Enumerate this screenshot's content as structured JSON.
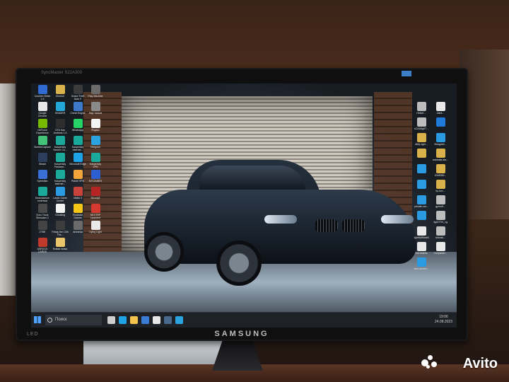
{
  "photo": {
    "monitor_brand": "SAMSUNG",
    "monitor_model_text": "SyncMaster S22A300",
    "led_label": "LED",
    "watermark_text": "Avito"
  },
  "desktop": {
    "left_icons": [
      {
        "label": "Counter-Strike 1.6",
        "color": "#2f6bd1"
      },
      {
        "label": "Личное",
        "color": "#d9b14a"
      },
      {
        "label": "Grand Theft Auto V",
        "color": "#3b3b3b"
      },
      {
        "label": "Play Machine",
        "color": "#6b6b6b"
      },
      {
        "label": "Google Chrome",
        "color": "#e8e8e8"
      },
      {
        "label": "SHADER",
        "color": "#23a7d9"
      },
      {
        "label": "Cheat Engine",
        "color": "#3e79c9"
      },
      {
        "label": "Мир танков",
        "color": "#8a8a8a"
      },
      {
        "label": "GeForce Experience",
        "color": "#76b900"
      },
      {
        "label": "GTA San Andreas 1.0",
        "color": "#2d2d2d"
      },
      {
        "label": "WhatsApp",
        "color": "#25d366"
      },
      {
        "label": "Яндекс",
        "color": "#f4f4f4"
      },
      {
        "label": "ScreenCapture",
        "color": "#44c277"
      },
      {
        "label": "Kaspersky Secure Co...",
        "color": "#1aa99a"
      },
      {
        "label": "Kaspersky Internet...",
        "color": "#1aa99a"
      },
      {
        "label": "Telegram",
        "color": "#2aa3e0"
      },
      {
        "label": "Steam",
        "color": "#2b3f5c"
      },
      {
        "label": "Kaspersky Passwor...",
        "color": "#1aa99a"
      },
      {
        "label": "Microsoft Edge",
        "color": "#1ea4e6"
      },
      {
        "label": "Kaspersky VPN",
        "color": "#1aa99a"
      },
      {
        "label": "Speedfan",
        "color": "#3a6fd6"
      },
      {
        "label": "Kaspersky Internet...",
        "color": "#1aa99a"
      },
      {
        "label": "Planet VPN",
        "color": "#f2a33a"
      },
      {
        "label": "MY.GAMES",
        "color": "#2e5fd1"
      },
      {
        "label": "Безопасные платежи",
        "color": "#1aa99a"
      },
      {
        "label": "Lastic Game Center",
        "color": "#2a9be0"
      },
      {
        "label": "Mafia II",
        "color": "#c9433a"
      },
      {
        "label": "Bloody8",
        "color": "#b52525"
      },
      {
        "label": "Euro Truck Simulator 2",
        "color": "#4a4a4a"
      },
      {
        "label": "Ghosting",
        "color": "#f2f2f2"
      },
      {
        "label": "Rockstar Games",
        "color": "#f5c518"
      },
      {
        "label": "NEXTRP Launcher",
        "color": "#d4392f"
      },
      {
        "label": "ZTBE",
        "color": "#444444"
      },
      {
        "label": "Friday the 13th The...",
        "color": "#3d3d3d"
      },
      {
        "label": "Amnesia",
        "color": "#6a6a6a"
      },
      {
        "label": "Dying Light",
        "color": "#e9e9e9"
      },
      {
        "label": "ASROCK CARDS",
        "color": "#c03a2b"
      },
      {
        "label": "Новая папка",
        "color": "#e9c46a"
      }
    ],
    "right_icons": [
      {
        "label": "HelloK...",
        "color": "#bcbcbc"
      },
      {
        "label": "2ab4...",
        "color": "#e8e8e8"
      },
      {
        "label": "sCAAAg07...",
        "color": "#bcbcbc"
      },
      {
        "label": "",
        "color": "#1f7ad9"
      },
      {
        "label": "dibly-ogm...",
        "color": "#d9b14a"
      },
      {
        "label": "Mosgwer...",
        "color": "#2a9be0"
      },
      {
        "label": "",
        "color": "#d9b14a"
      },
      {
        "label": "australia-sta...",
        "color": "#d9b14a"
      },
      {
        "label": "",
        "color": "#2a9be0"
      },
      {
        "label": "2018060...",
        "color": "#d9b14a"
      },
      {
        "label": "",
        "color": "#2a9be0"
      },
      {
        "label": "ky-kvo...",
        "color": "#d9b14a"
      },
      {
        "label": "private-car...",
        "color": "#2a9be0"
      },
      {
        "label": "gyrno5...",
        "color": "#bcbcbc"
      },
      {
        "label": "",
        "color": "#2a9be0"
      },
      {
        "label": "4gs1YXe_vg",
        "color": "#bcbcbc"
      },
      {
        "label": "1gm6aWotal4",
        "color": "#e8e8e8"
      },
      {
        "label": "dobosk...",
        "color": "#bcbcbc"
      },
      {
        "label": "Без имени",
        "color": "#e8e8e8"
      },
      {
        "label": "Сохранен...",
        "color": "#e8e8e8"
      },
      {
        "label": "new-screen...",
        "color": "#2a9be0"
      }
    ],
    "search_placeholder": "Поиск",
    "clock_time": "19:06",
    "clock_date": "24.08.2023",
    "taskbar_icons": [
      {
        "name": "task-view-icon",
        "color": "#cfcfcf"
      },
      {
        "name": "edge-icon",
        "color": "#1ea4e6"
      },
      {
        "name": "explorer-icon",
        "color": "#f2c14e"
      },
      {
        "name": "store-icon",
        "color": "#3a7bd5"
      },
      {
        "name": "chrome-icon",
        "color": "#e8e8e8"
      },
      {
        "name": "steam-icon",
        "color": "#4a6a8c"
      },
      {
        "name": "telegram-icon",
        "color": "#2aa3e0"
      }
    ]
  }
}
